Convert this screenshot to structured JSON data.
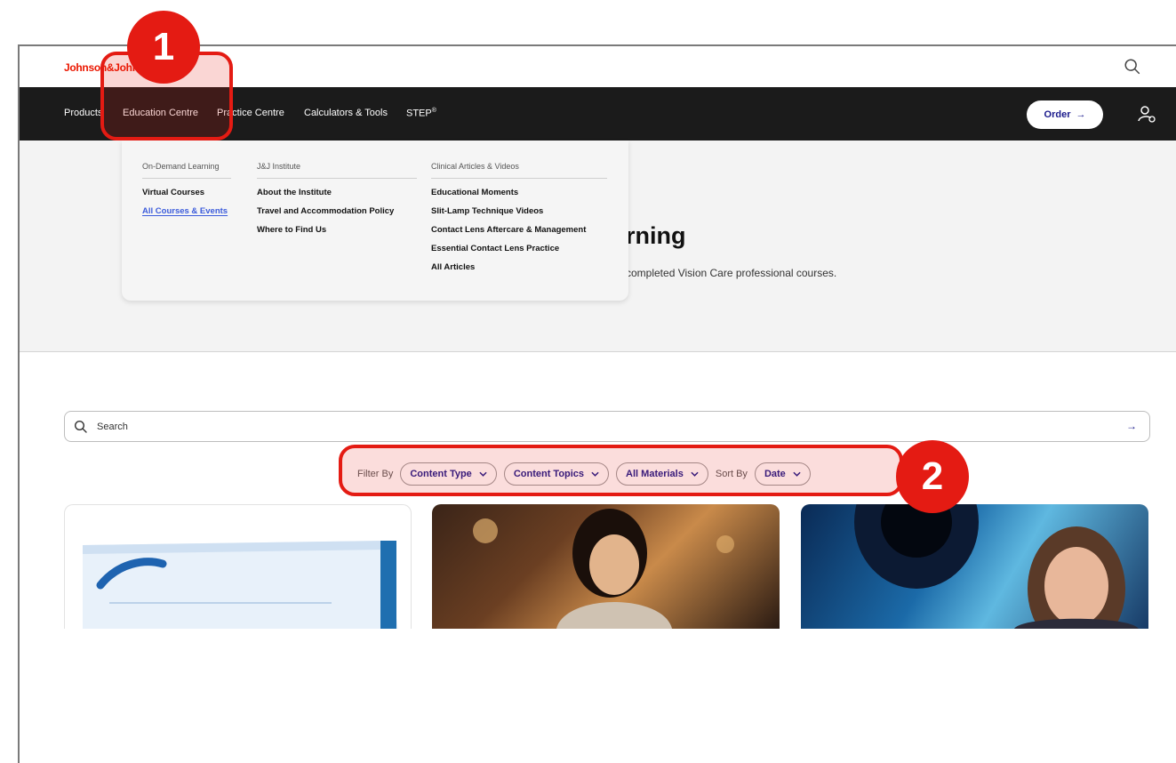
{
  "header": {
    "logo_text": "Johnson&Johnson",
    "nav": [
      {
        "label": "Products"
      },
      {
        "label": "Education Centre"
      },
      {
        "label": "Practice Centre"
      },
      {
        "label": "Calculators & Tools"
      },
      {
        "label": "STEP",
        "sup": "®"
      }
    ],
    "order_label": "Order",
    "order_arrow": "→"
  },
  "dropdown": {
    "columns": [
      {
        "heading": "On-Demand Learning",
        "links": [
          "Virtual Courses",
          "All Courses & Events"
        ]
      },
      {
        "heading": "J&J Institute",
        "links": [
          "About the Institute",
          "Travel and Accommodation Policy",
          "Where to Find Us"
        ]
      },
      {
        "heading": "Clinical Articles & Videos",
        "links": [
          "Educational Moments",
          "Slit-Lamp Technique Videos",
          "Contact Lens Aftercare & Management",
          "Essential Contact Lens Practice",
          "All Articles"
        ]
      }
    ],
    "active_link": "All Courses & Events"
  },
  "hero": {
    "title_visible": "rning",
    "subtitle_visible": "completed Vision Care professional courses."
  },
  "search": {
    "placeholder": "Search",
    "go_arrow": "→"
  },
  "filters": {
    "filter_by_label": "Filter By",
    "chips": [
      "Content Type",
      "Content Topics",
      "All Materials"
    ],
    "sort_by_label": "Sort By",
    "sort_chip": "Date"
  },
  "annotations": {
    "badge1": "1",
    "badge2": "2"
  },
  "colors": {
    "brand_red": "#eb1700",
    "nav_bg": "#1b1b1b",
    "accent_blue": "#1a1a8c",
    "annotation_red": "#e41b13"
  }
}
